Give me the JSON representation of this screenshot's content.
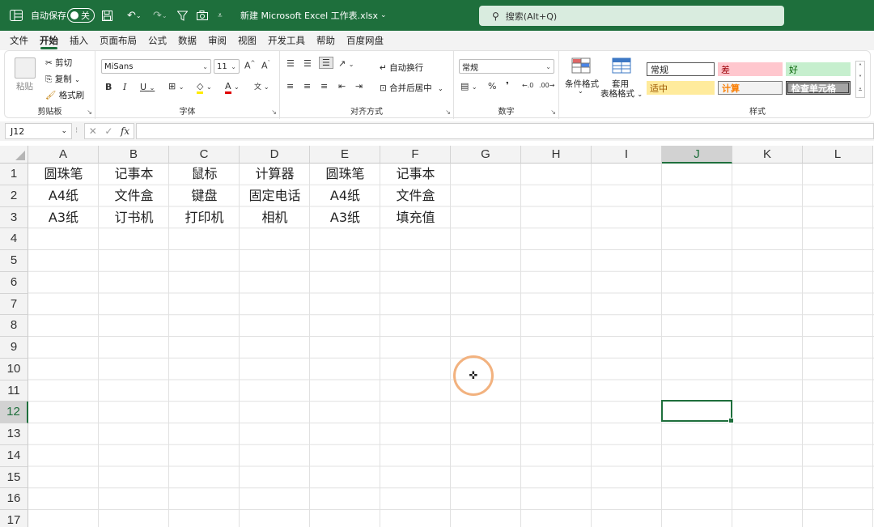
{
  "titlebar": {
    "autosave_label": "自动保存",
    "autosave_state": "关",
    "filename": "新建 Microsoft Excel 工作表.xlsx",
    "search_placeholder": "搜索(Alt+Q)"
  },
  "menu": [
    "文件",
    "开始",
    "插入",
    "页面布局",
    "公式",
    "数据",
    "审阅",
    "视图",
    "开发工具",
    "帮助",
    "百度网盘"
  ],
  "ribbon": {
    "clipboard": {
      "paste": "粘贴",
      "cut": "剪切",
      "copy": "复制",
      "format_painter": "格式刷",
      "label": "剪贴板"
    },
    "font": {
      "name": "MiSans",
      "size": "11",
      "label": "字体"
    },
    "alignment": {
      "wrap": "自动换行",
      "merge": "合并后居中",
      "label": "对齐方式"
    },
    "number": {
      "format": "常规",
      "label": "数字"
    },
    "cond_format": "条件格式",
    "table_format_1": "套用",
    "table_format_2": "表格格式",
    "styles": {
      "normal": "常规",
      "bad": "差",
      "good": "好",
      "neutral": "适中",
      "calc": "计算",
      "check": "检查单元格",
      "label": "样式"
    }
  },
  "formula_bar": {
    "name_box": "J12",
    "fx": "fx"
  },
  "columns": [
    "A",
    "B",
    "C",
    "D",
    "E",
    "F",
    "G",
    "H",
    "I",
    "J",
    "K",
    "L"
  ],
  "rows": [
    "1",
    "2",
    "3",
    "4",
    "5",
    "6",
    "7",
    "8",
    "9",
    "10",
    "11",
    "12",
    "13",
    "14",
    "15",
    "16",
    "17"
  ],
  "cells": [
    [
      "圆珠笔",
      "记事本",
      "鼠标",
      "计算器",
      "圆珠笔",
      "记事本"
    ],
    [
      "A4纸",
      "文件盒",
      "键盘",
      "固定电话",
      "A4纸",
      "文件盒"
    ],
    [
      "A3纸",
      "订书机",
      "打印机",
      "相机",
      "A3纸",
      "填充值"
    ]
  ],
  "colors": {
    "accent": "#1e6f3c",
    "bad": "#ffc7ce",
    "good": "#c6efce",
    "neutral": "#ffeb9c",
    "calc": "#f2f2f2",
    "cursor": "#f2b27f"
  }
}
